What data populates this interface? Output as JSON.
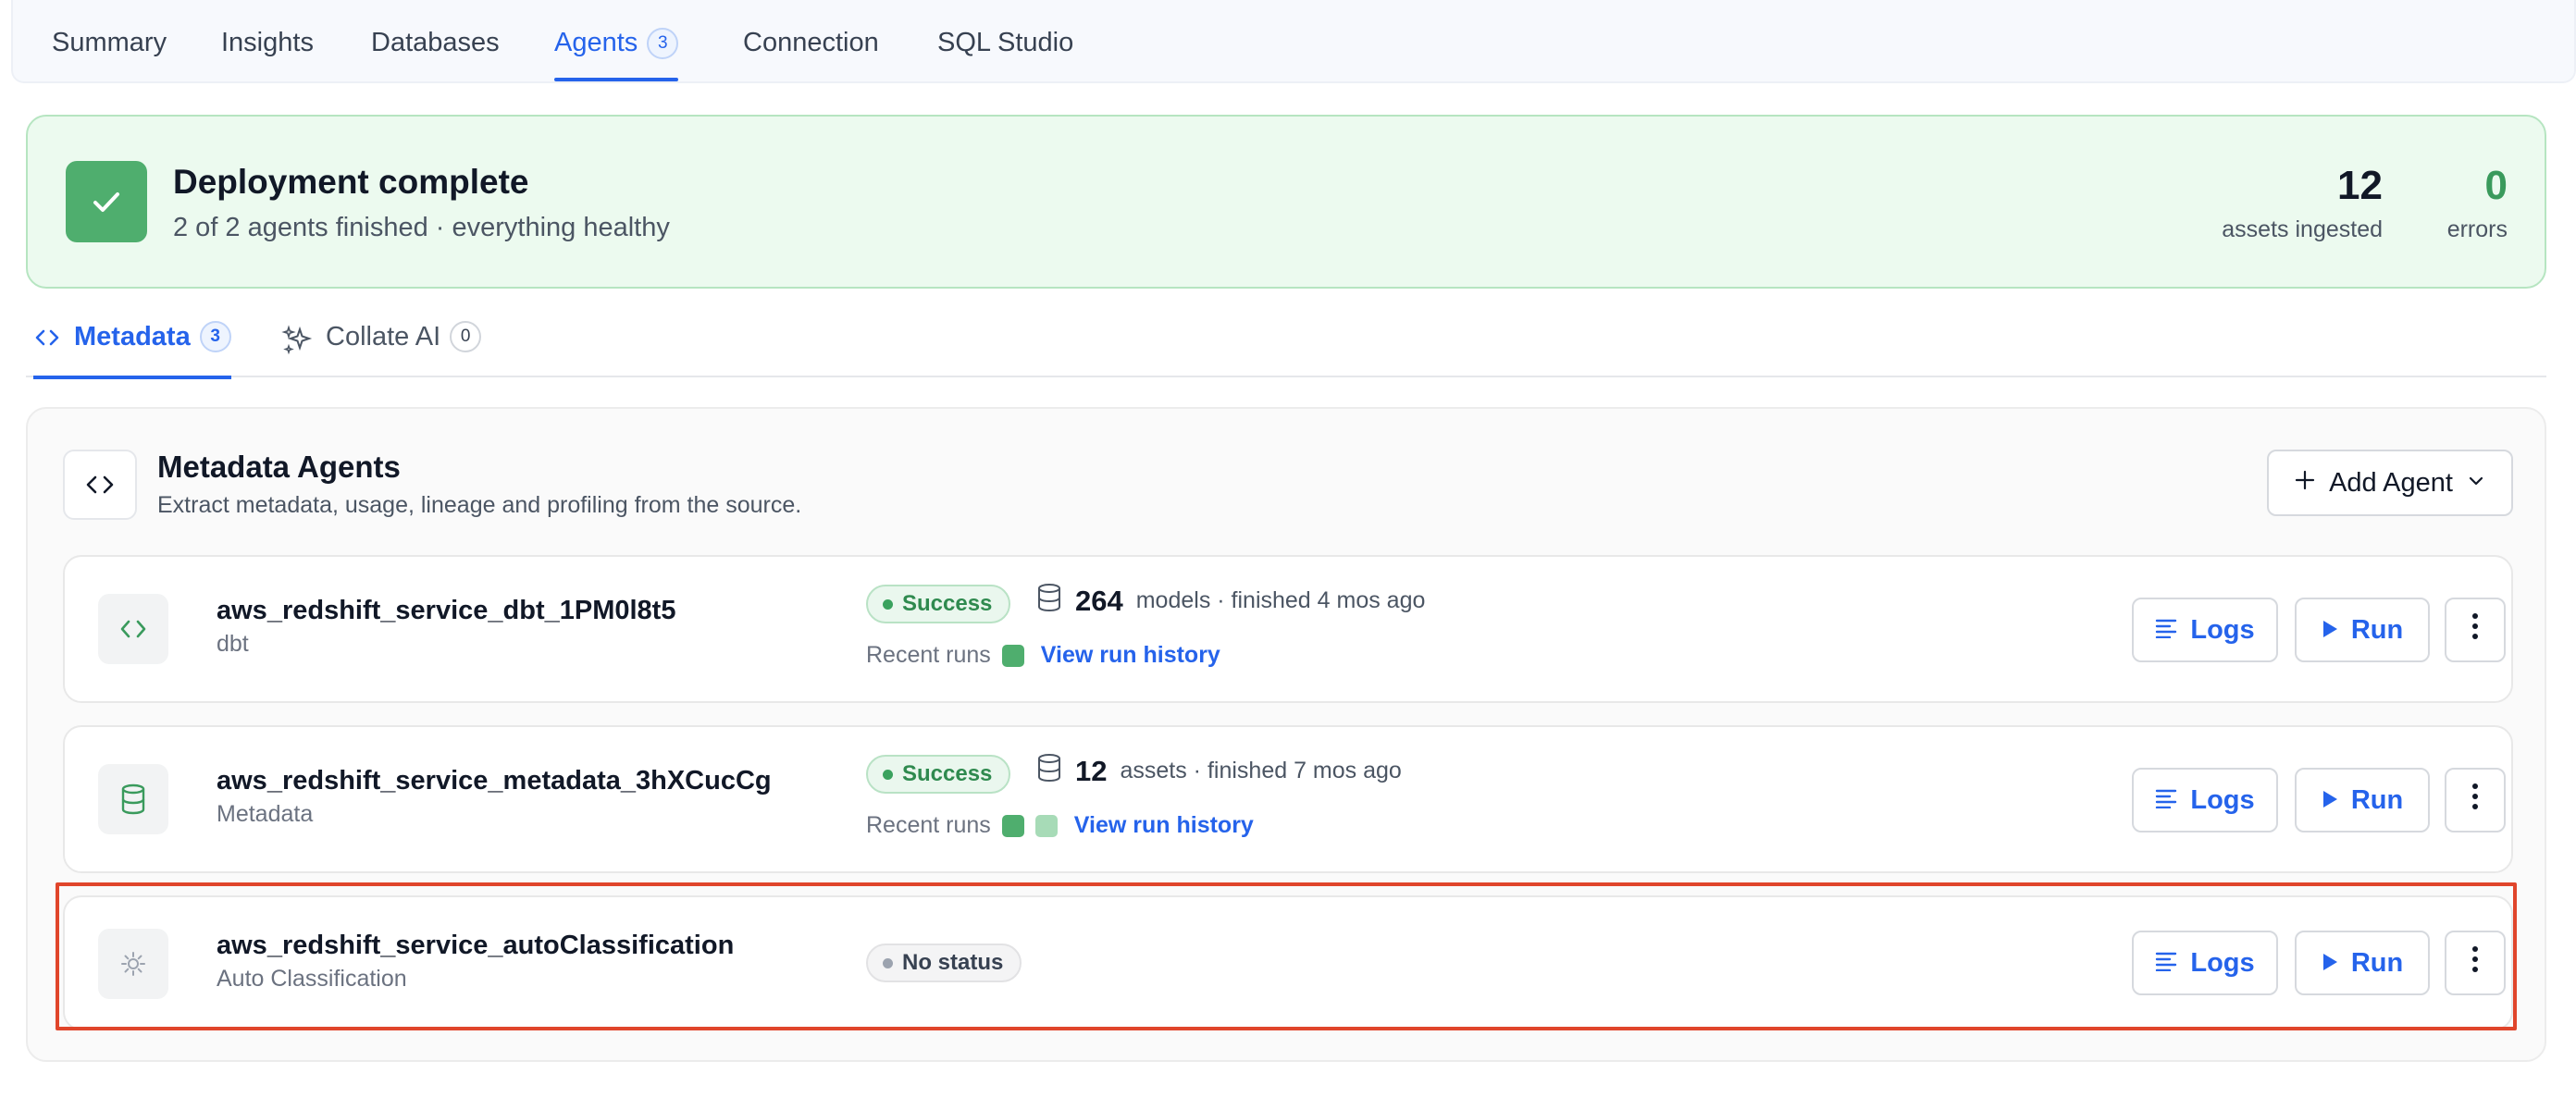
{
  "top_tabs": [
    {
      "label": "Summary"
    },
    {
      "label": "Insights"
    },
    {
      "label": "Databases"
    },
    {
      "label": "Agents",
      "count": "3",
      "active": true
    },
    {
      "label": "Connection"
    },
    {
      "label": "SQL Studio"
    }
  ],
  "banner": {
    "title": "Deployment complete",
    "subtitle": "2 of 2 agents finished · everything healthy",
    "assets_value": "12",
    "assets_label": "assets ingested",
    "errors_value": "0",
    "errors_label": "errors"
  },
  "sub_tabs": {
    "metadata_label": "Metadata",
    "metadata_count": "3",
    "collate_label": "Collate AI",
    "collate_count": "0"
  },
  "panel": {
    "title": "Metadata Agents",
    "subtitle": "Extract metadata, usage, lineage and profiling from the source.",
    "add_agent_label": "Add Agent"
  },
  "agents": [
    {
      "name": "aws_redshift_service_dbt_1PM0l8t5",
      "type": "dbt",
      "icon": "code-icon",
      "status": "Success",
      "metric_value": "264",
      "metric_text": "models · finished 4 mos ago",
      "recent_label": "Recent runs",
      "recent_runs": [
        "success"
      ],
      "history_label": "View run history"
    },
    {
      "name": "aws_redshift_service_metadata_3hXCucCg",
      "type": "Metadata",
      "icon": "database-icon",
      "status": "Success",
      "metric_value": "12",
      "metric_text": "assets · finished 7 mos ago",
      "recent_label": "Recent runs",
      "recent_runs": [
        "success",
        "success"
      ],
      "history_label": "View run history"
    },
    {
      "name": "aws_redshift_service_autoClassification",
      "type": "Auto Classification",
      "icon": "sun-icon",
      "status": "No status"
    }
  ],
  "buttons": {
    "logs_label": "Logs",
    "run_label": "Run"
  },
  "colors": {
    "accent": "#2563eb",
    "success": "#4fae6e",
    "highlight": "#e0452b"
  }
}
